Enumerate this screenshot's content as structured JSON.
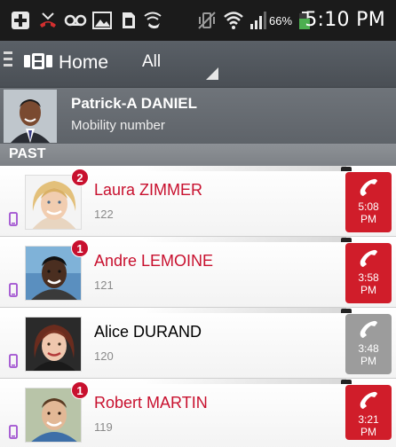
{
  "status_bar": {
    "battery_percent": "66%",
    "time": "5:10 PM",
    "icons": [
      "add-box-icon",
      "missed-call-icon",
      "voicemail-icon",
      "image-icon",
      "sim-icon",
      "wifi-calling-icon",
      "vibrate-icon",
      "wifi-icon",
      "signal-icon",
      "battery-icon"
    ]
  },
  "app_bar": {
    "title": "Home",
    "filter": "All"
  },
  "profile": {
    "name": "Patrick-A DANIEL",
    "subtitle": "Mobility number"
  },
  "section": {
    "title": "PAST"
  },
  "colors": {
    "missed": "#c8102e",
    "answered_button": "#9c9c9c",
    "missed_button": "#d01d2a",
    "device_icon": "#a050d0"
  },
  "calls": [
    {
      "name": "Laura ZIMMER",
      "number": "122",
      "badge": "2",
      "time_line1": "5:08",
      "time_line2": "PM",
      "missed": true
    },
    {
      "name": "Andre LEMOINE",
      "number": "121",
      "badge": "1",
      "time_line1": "3:58",
      "time_line2": "PM",
      "missed": true
    },
    {
      "name": "Alice DURAND",
      "number": "120",
      "badge": "",
      "time_line1": "3:48",
      "time_line2": "PM",
      "missed": false
    },
    {
      "name": "Robert MARTIN",
      "number": "119",
      "badge": "1",
      "time_line1": "3:21",
      "time_line2": "PM",
      "missed": true
    }
  ]
}
